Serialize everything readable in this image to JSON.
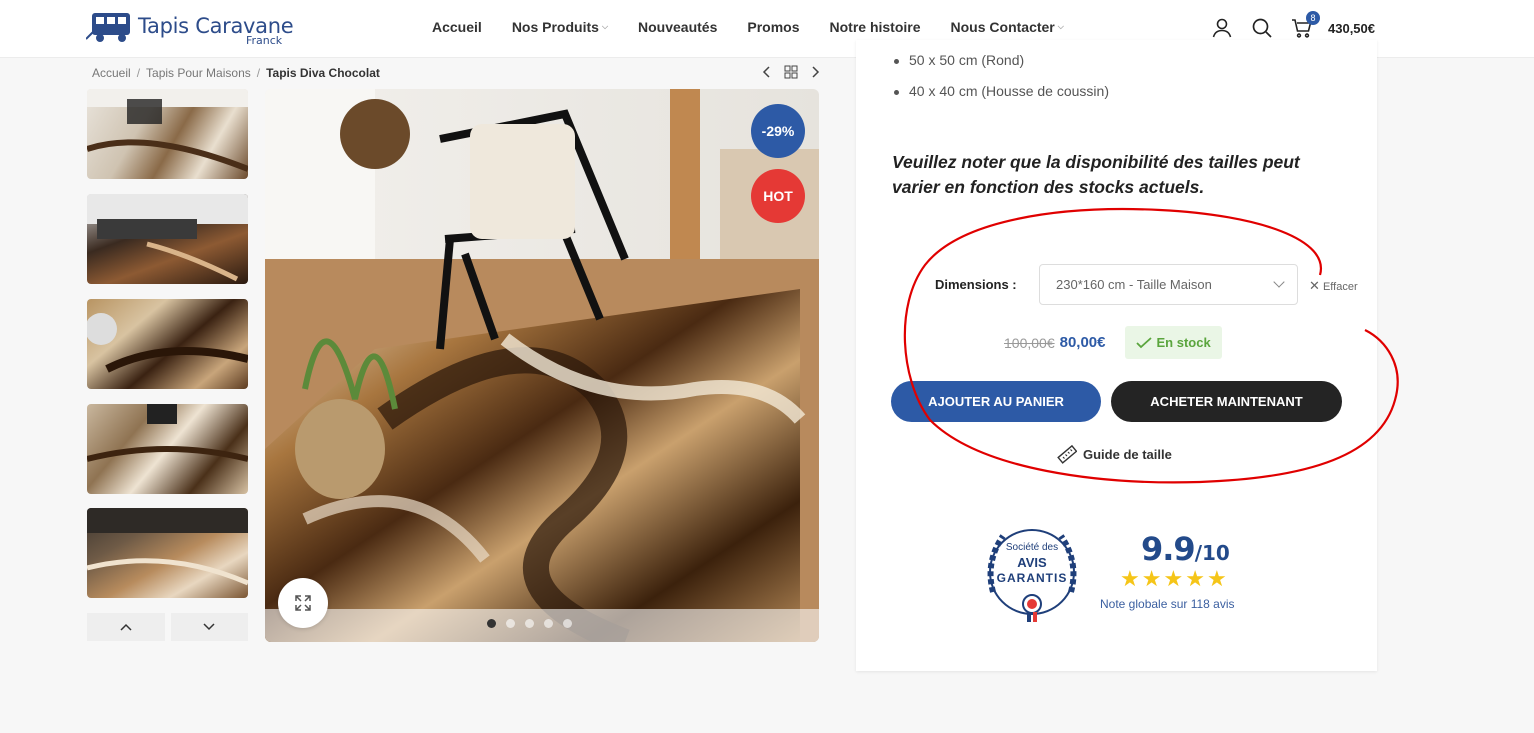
{
  "header": {
    "logo_title": "Tapis Caravane",
    "logo_subtitle": "Franck",
    "nav": [
      {
        "label": "Accueil",
        "has_dropdown": false
      },
      {
        "label": "Nos Produits",
        "has_dropdown": true
      },
      {
        "label": "Nouveautés",
        "has_dropdown": false
      },
      {
        "label": "Promos",
        "has_dropdown": false
      },
      {
        "label": "Notre histoire",
        "has_dropdown": false
      },
      {
        "label": "Nous Contacter",
        "has_dropdown": true
      }
    ],
    "icons": [
      "user-icon",
      "search-icon",
      "cart-icon"
    ],
    "cart_count": "8",
    "cart_total": "430,50€"
  },
  "breadcrumb": {
    "items": [
      "Accueil",
      "Tapis Pour Maisons",
      "Tapis Diva Chocolat"
    ]
  },
  "product": {
    "badges": {
      "sale": "-29%",
      "hot": "HOT"
    },
    "size_list": [
      "50 x 50 cm (Rond)",
      "40 x 40 cm (Housse de coussin)"
    ],
    "note": "Veuillez noter que la disponibilité des tailles peut varier en fonction des stocks actuels.",
    "dimensions_label": "Dimensions :",
    "dimensions_value": "230*160 cm - Taille Maison",
    "clear_label": "Effacer",
    "old_price": "100,00€",
    "new_price": "80,00€",
    "stock_label": "En stock",
    "add_to_cart": "AJOUTER AU PANIER",
    "buy_now": "ACHETER MAINTENANT",
    "size_guide": "Guide de taille"
  },
  "reviews": {
    "seal_line1": "Société des",
    "seal_line2": "AVIS",
    "seal_line3": "GARANTIS",
    "score": "9.9",
    "score_max": "/10",
    "stars": 5,
    "note": "Note globale sur 118 avis"
  },
  "colors": {
    "brand_blue": "#2d5aa6",
    "hot_red": "#e53935",
    "dark_button": "#242424",
    "stock_green": "#5aa53d",
    "annotation_red": "#e00000"
  }
}
